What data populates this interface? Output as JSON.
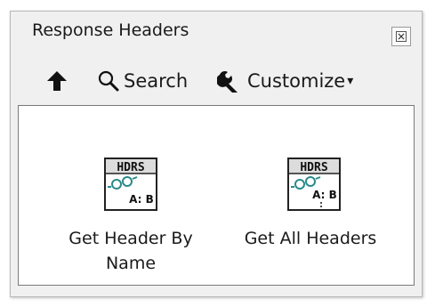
{
  "window": {
    "title": "Response Headers"
  },
  "toolbar": {
    "search_label": "Search",
    "customize_label": "Customize",
    "customize_arrow": "▾"
  },
  "items": [
    {
      "label": "Get Header By Name",
      "icon_header": "HDRS",
      "icon_text": "A: B"
    },
    {
      "label": "Get All Headers",
      "icon_header": "HDRS",
      "icon_text": "A: B"
    }
  ],
  "icons": {
    "close": "close-icon",
    "up": "up-arrow-icon",
    "search": "search-icon",
    "customize": "wrench-icon"
  }
}
